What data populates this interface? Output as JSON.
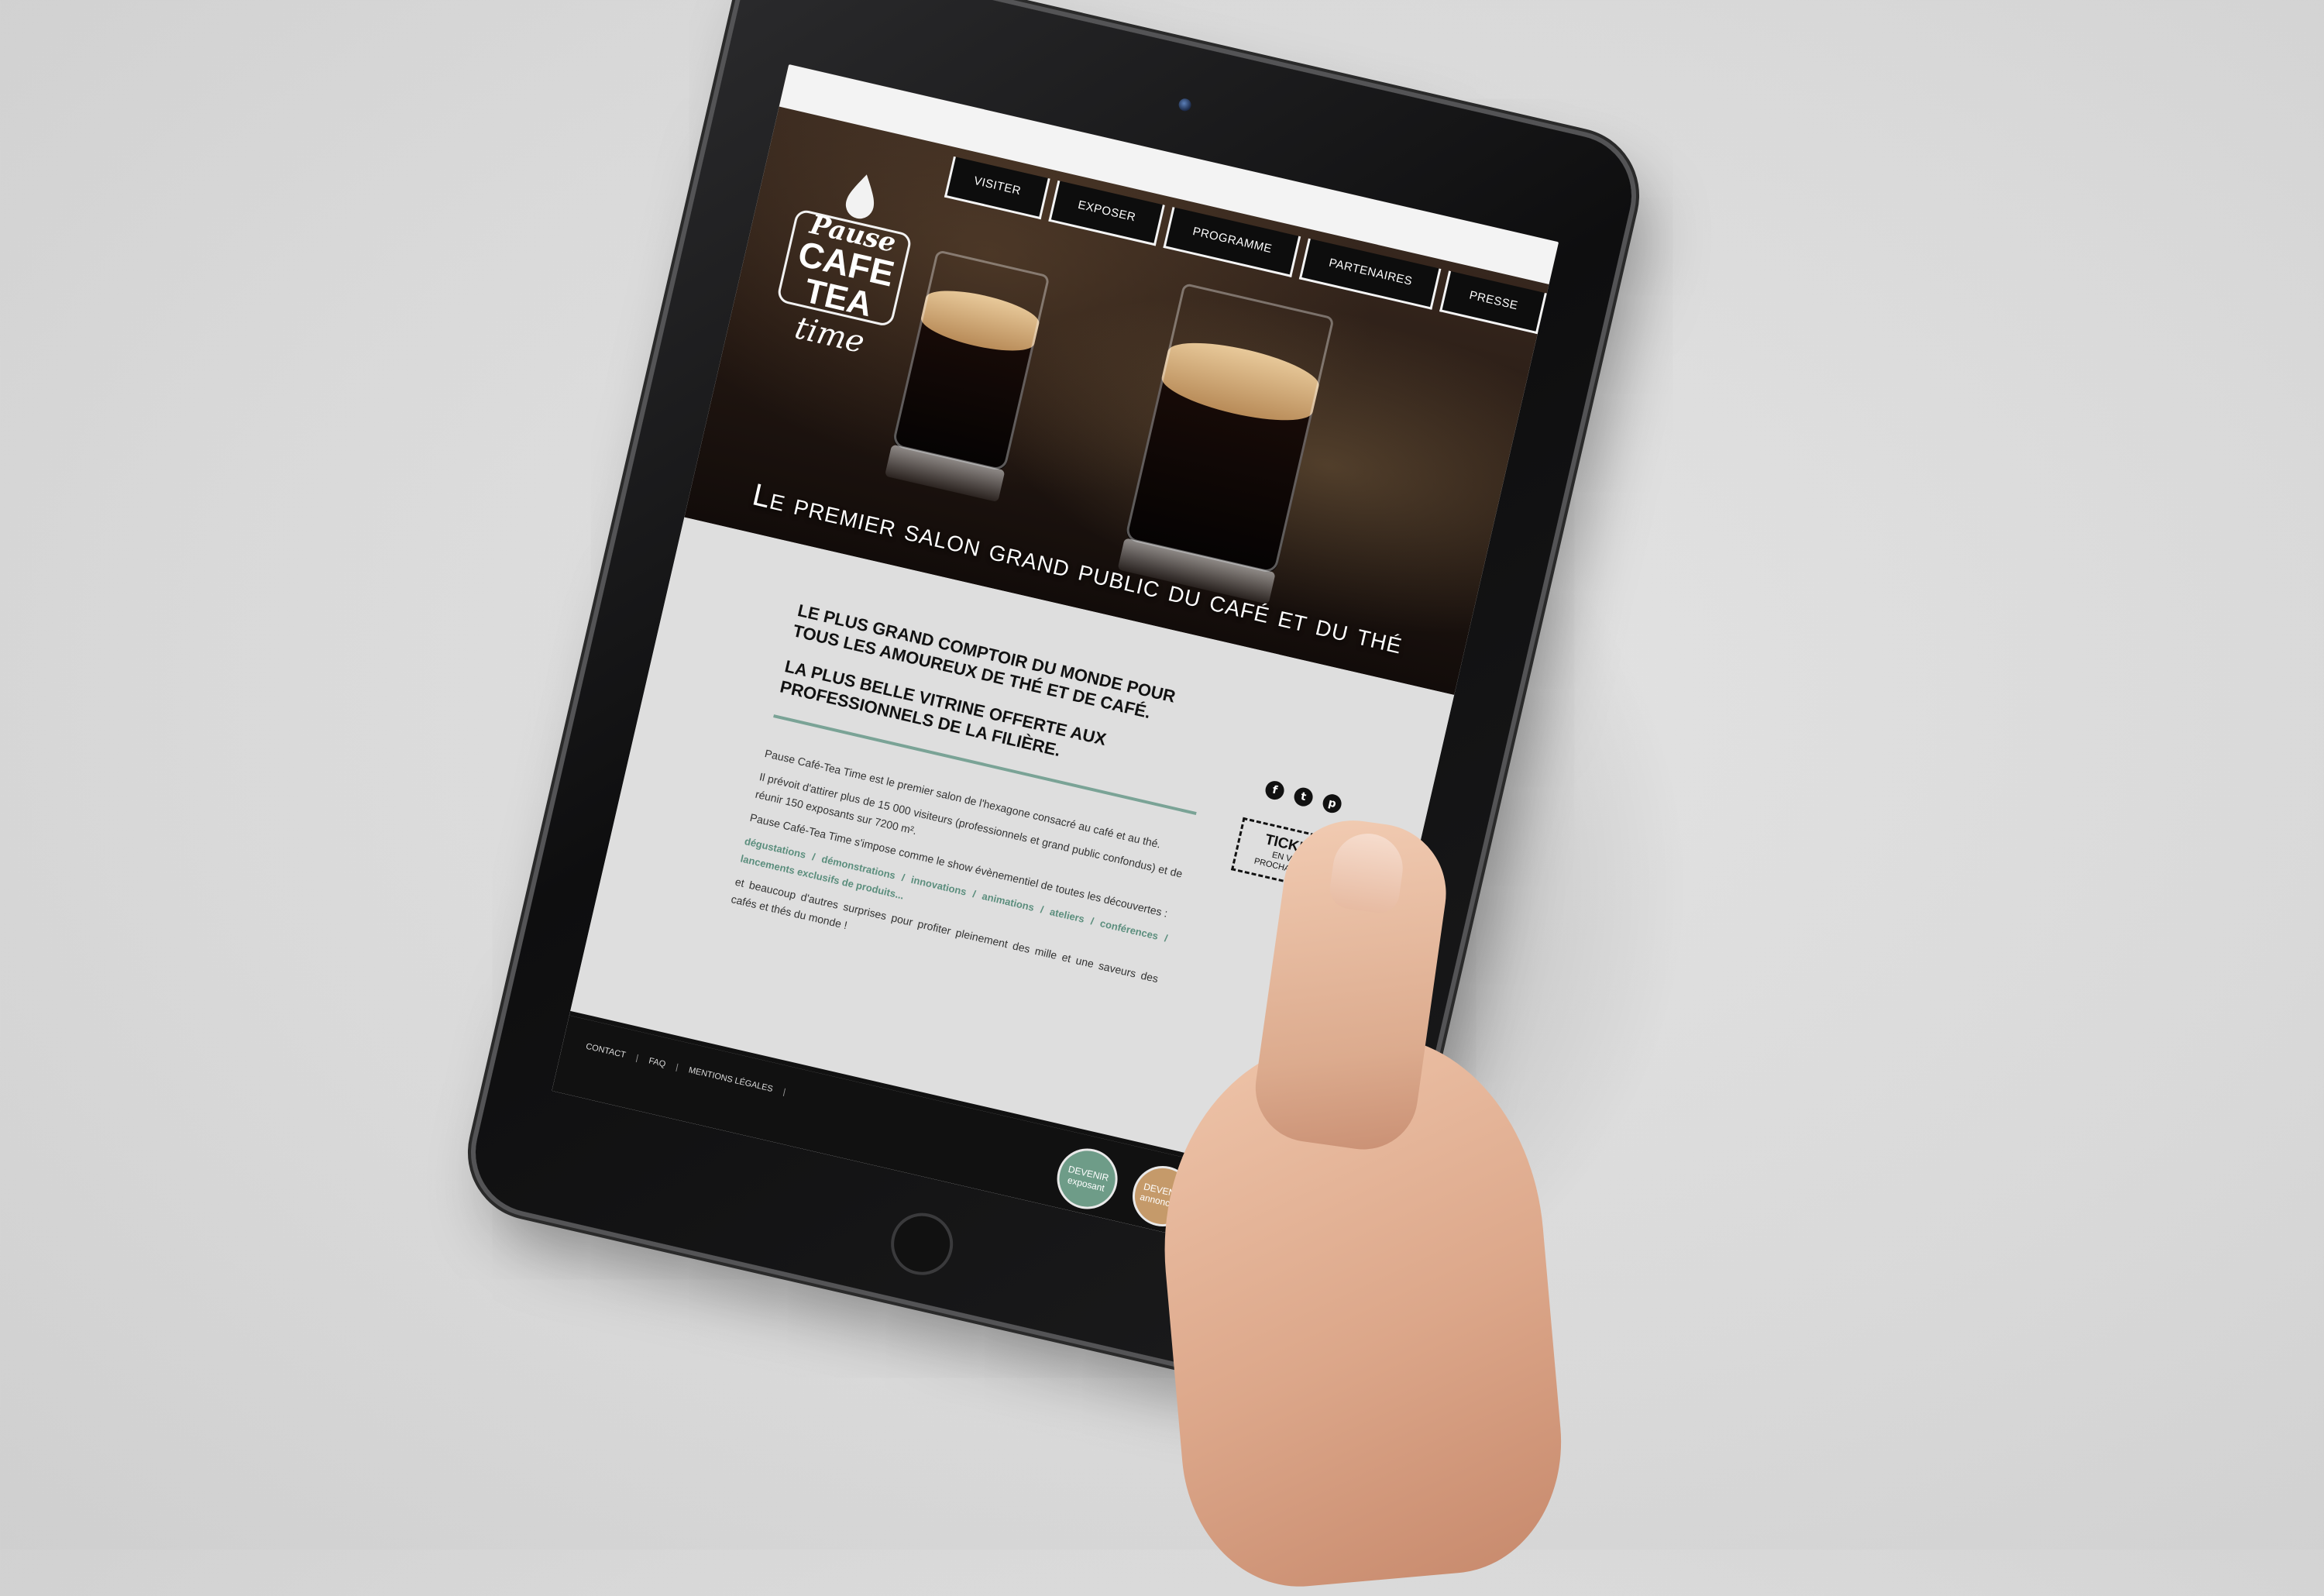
{
  "site": {
    "logo": {
      "line1": "Pause",
      "line2": "CAFE",
      "line3": "TEA",
      "line4": "time"
    },
    "nav": [
      {
        "label": "Visiter"
      },
      {
        "label": "Exposer"
      },
      {
        "label": "Programme"
      },
      {
        "label": "Partenaires"
      },
      {
        "label": "Presse"
      }
    ],
    "tagline": "Le premier salon grand public du café et du thé",
    "headline": {
      "p1": "Le plus grand comptoir du monde pour tous les amoureux de thé et de café.",
      "p2": "La plus belle vitrine offerte aux professionnels de la filière."
    },
    "social": {
      "facebook": "f",
      "twitter": "t",
      "pinterest": "p"
    },
    "tickets": {
      "title": "TICKETS",
      "subtitle": "EN VENTE PROCHAINEMENT"
    },
    "body": {
      "p1": "Pause Café-Tea Time est le premier salon de l'hexagone consacré au café et au thé.",
      "p2": "Il prévoit d'attirer plus de 15 000 visiteurs (professionnels et grand public confondus) et de réunir 150 exposants sur 7200 m².",
      "p3": "Pause Café-Tea Time s'impose comme le show évènementiel de toutes les découvertes :",
      "highlights": "dégustations / démonstrations / innovations / animations / ateliers / conférences / lancements exclusifs de produits...",
      "p4": "et beaucoup d'autres surprises pour profiter pleinement des mille et une saveurs des cafés et thés du monde !"
    },
    "footer": [
      {
        "label": "Contact"
      },
      {
        "label": "FAQ"
      },
      {
        "label": "Mentions légales"
      }
    ],
    "badges": [
      {
        "line1": "DEVENIR",
        "line2": "exposant"
      },
      {
        "line1": "DEVENIR",
        "line2": "annonceur"
      }
    ]
  },
  "colors": {
    "accent_green": "#6e9c88",
    "accent_tan": "#c59a6a",
    "rule": "#7aa396"
  }
}
